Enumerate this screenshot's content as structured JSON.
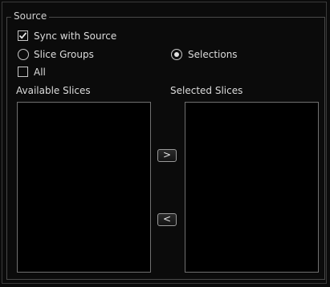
{
  "group": {
    "title": "Source"
  },
  "options": {
    "sync_with_source": {
      "label": "Sync with Source",
      "checked": true
    },
    "slice_groups": {
      "label": "Slice Groups",
      "selected": false
    },
    "selections": {
      "label": "Selections",
      "selected": true
    },
    "all": {
      "label": "All",
      "checked": false
    }
  },
  "lists": {
    "available": {
      "label": "Available Slices",
      "items": []
    },
    "selected": {
      "label": "Selected Slices",
      "items": []
    }
  },
  "buttons": {
    "add": ">",
    "remove": "<"
  }
}
